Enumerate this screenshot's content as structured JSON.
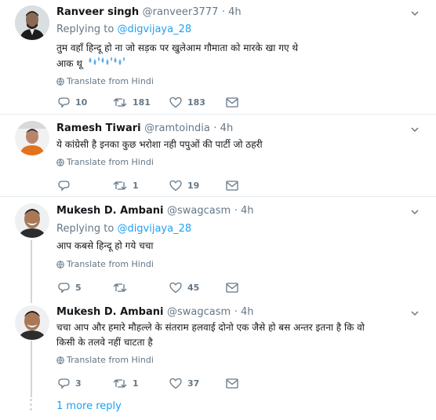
{
  "tweets": [
    {
      "name": "Ranveer singh",
      "handle": "@ranveer3777",
      "time": "· 4h",
      "replying_prefix": "Replying to ",
      "replying_handle": "@digvijaya_28",
      "text_line1": "तुम वहाँ हिन्दू हो ना जो सड़क पर खुलेआम गौमाता को मारके खा गए थे",
      "text_line2": "आक थू",
      "emoji": [
        "sweat-droplets",
        "sweat-droplets",
        "sweat-droplets"
      ],
      "translate": "Translate from Hindi",
      "reply_count": "10",
      "retweet_count": "181",
      "like_count": "183"
    },
    {
      "name": "Ramesh Tiwari",
      "handle": "@ramtoindia",
      "time": "· 4h",
      "text_line1": "ये कांग्रेसी है इनका कुछ भरोशा नही पपुओं की पार्टी जो ठहरी",
      "translate": "Translate from Hindi",
      "reply_count": "",
      "retweet_count": "1",
      "like_count": "19"
    },
    {
      "name": "Mukesh D. Ambani",
      "handle": "@swagcasm",
      "time": "· 4h",
      "replying_prefix": "Replying to ",
      "replying_handle": "@digvijaya_28",
      "text_line1": "आप कबसे हिन्दू हो गये चचा",
      "translate": "Translate from Hindi",
      "reply_count": "5",
      "retweet_count": "",
      "like_count": "45"
    },
    {
      "name": "Mukesh D. Ambani",
      "handle": "@swagcasm",
      "time": "· 4h",
      "text_line1": "चचा आप और हमारे मौहल्ले के संतराम हलवाई दोनो एक जैसे हो बस अन्तर इतना है कि वो",
      "text_line2": "किसी के तलवे नहीं चाटता है",
      "translate": "Translate from Hindi",
      "reply_count": "3",
      "retweet_count": "1",
      "like_count": "37"
    }
  ],
  "more_replies": "1 more reply",
  "colors": {
    "accent": "#1da1f2",
    "muted": "#657786",
    "icon": "#657786",
    "line": "#ccd6dd"
  },
  "icons": [
    "caret-down-icon",
    "globe-icon",
    "reply-icon",
    "retweet-icon",
    "like-icon",
    "message-icon"
  ]
}
